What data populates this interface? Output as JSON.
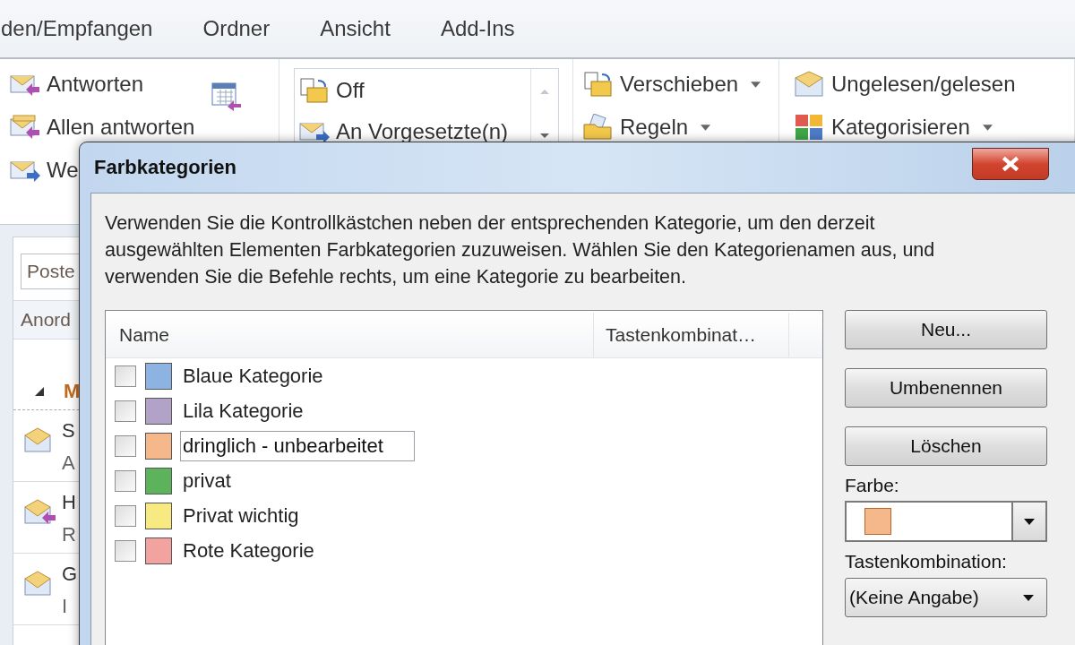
{
  "menu_tabs": [
    "den/Empfangen",
    "Ordner",
    "Ansicht",
    "Add-Ins"
  ],
  "ribbon": {
    "respond": [
      {
        "label": "Antworten",
        "kind": "reply"
      },
      {
        "label": "Allen antworten",
        "kind": "reply-all"
      },
      {
        "label": "We",
        "kind": "forward"
      }
    ],
    "quick_steps": [
      {
        "label": "Off",
        "kind": "move"
      },
      {
        "label": "An Vorgesetzte(n)",
        "kind": "forward"
      }
    ],
    "move": [
      {
        "label": "Verschieben",
        "kind": "move",
        "dropdown": true
      },
      {
        "label": "Regeln",
        "kind": "rules",
        "dropdown": true
      }
    ],
    "tags": [
      {
        "label": "Ungelesen/gelesen",
        "kind": "envelope",
        "dropdown": false
      },
      {
        "label": "Kategorisieren",
        "kind": "categories",
        "dropdown": true
      }
    ]
  },
  "mail_pane": {
    "search": {
      "placeholder": "Poste"
    },
    "arrange_label": "Anord",
    "group_header": "M",
    "mails": [
      {
        "kind": "read",
        "line1": "S",
        "line2": "A"
      },
      {
        "kind": "replied",
        "line1": "H",
        "line2": "R"
      },
      {
        "kind": "read",
        "line1": "G",
        "line2": "I"
      }
    ]
  },
  "dialog": {
    "title": "Farbkategorien",
    "description": "Verwenden Sie die Kontrollkästchen neben der entsprechenden Kategorie, um den derzeit ausgewählten Elementen Farbkategorien zuzuweisen. Wählen Sie den Kategorienamen aus, und verwenden Sie die Befehle rechts, um eine Kategorie zu bearbeiten.",
    "columns": [
      "Name",
      "Tastenkombinat…"
    ],
    "categories": [
      {
        "name": "Blaue Kategorie",
        "color": "#8db3e2",
        "checked": false,
        "editing": false
      },
      {
        "name": "Lila Kategorie",
        "color": "#b3a2c7",
        "checked": false,
        "editing": false
      },
      {
        "name": "dringlich - unbearbeitet",
        "color": "#f5b88a",
        "checked": false,
        "editing": true
      },
      {
        "name": "privat",
        "color": "#5cb35c",
        "checked": false,
        "editing": false
      },
      {
        "name": "Privat wichtig",
        "color": "#f7ea82",
        "checked": false,
        "editing": false
      },
      {
        "name": "Rote Kategorie",
        "color": "#f2a3a0",
        "checked": false,
        "editing": false
      }
    ],
    "buttons": [
      "Neu...",
      "Umbenennen",
      "Löschen"
    ],
    "color_label": "Farbe:",
    "color": "#f5b88a",
    "shortcut_label": "Tastenkombination:",
    "shortcut": "(Keine Angabe)"
  }
}
